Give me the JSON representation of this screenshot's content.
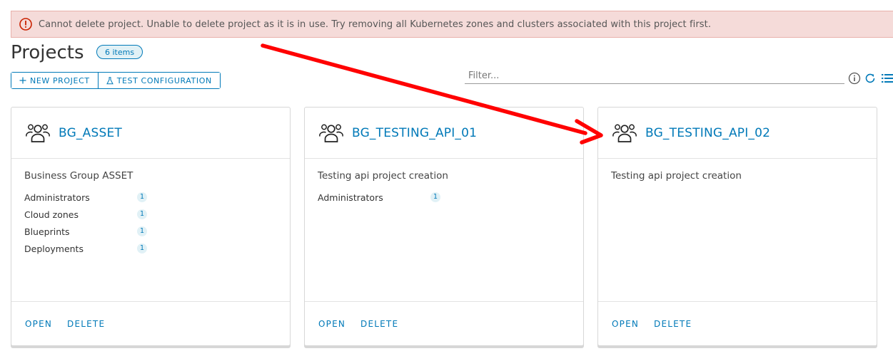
{
  "alert": {
    "message": "Cannot delete project. Unable to delete project as it is in use. Try removing all Kubernetes zones and clusters associated with this project first.",
    "icon": "error-circle-icon",
    "color": "#c92100"
  },
  "header": {
    "title": "Projects",
    "count_badge": "6 items"
  },
  "toolbar": {
    "new_project": "NEW PROJECT",
    "test_configuration": "TEST CONFIGURATION",
    "filter_placeholder": "Filter...",
    "icons": [
      "info-icon",
      "refresh-icon",
      "list-view-icon"
    ]
  },
  "cards": [
    {
      "title": "BG_ASSET",
      "description": "Business Group ASSET",
      "stats": [
        {
          "label": "Administrators",
          "value": "1"
        },
        {
          "label": "Cloud zones",
          "value": "1"
        },
        {
          "label": "Blueprints",
          "value": "1"
        },
        {
          "label": "Deployments",
          "value": "1"
        }
      ],
      "actions": {
        "open": "OPEN",
        "delete": "DELETE"
      }
    },
    {
      "title": "BG_TESTING_API_01",
      "description": "Testing api project creation",
      "stats": [
        {
          "label": "Administrators",
          "value": "1"
        }
      ],
      "actions": {
        "open": "OPEN",
        "delete": "DELETE"
      }
    },
    {
      "title": "BG_TESTING_API_02",
      "description": "Testing api project creation",
      "stats": [],
      "actions": {
        "open": "OPEN",
        "delete": "DELETE"
      }
    }
  ],
  "colors": {
    "accent": "#0079b8",
    "alert_bg": "#f5dbd9",
    "annotation_arrow": "#ff0000"
  }
}
